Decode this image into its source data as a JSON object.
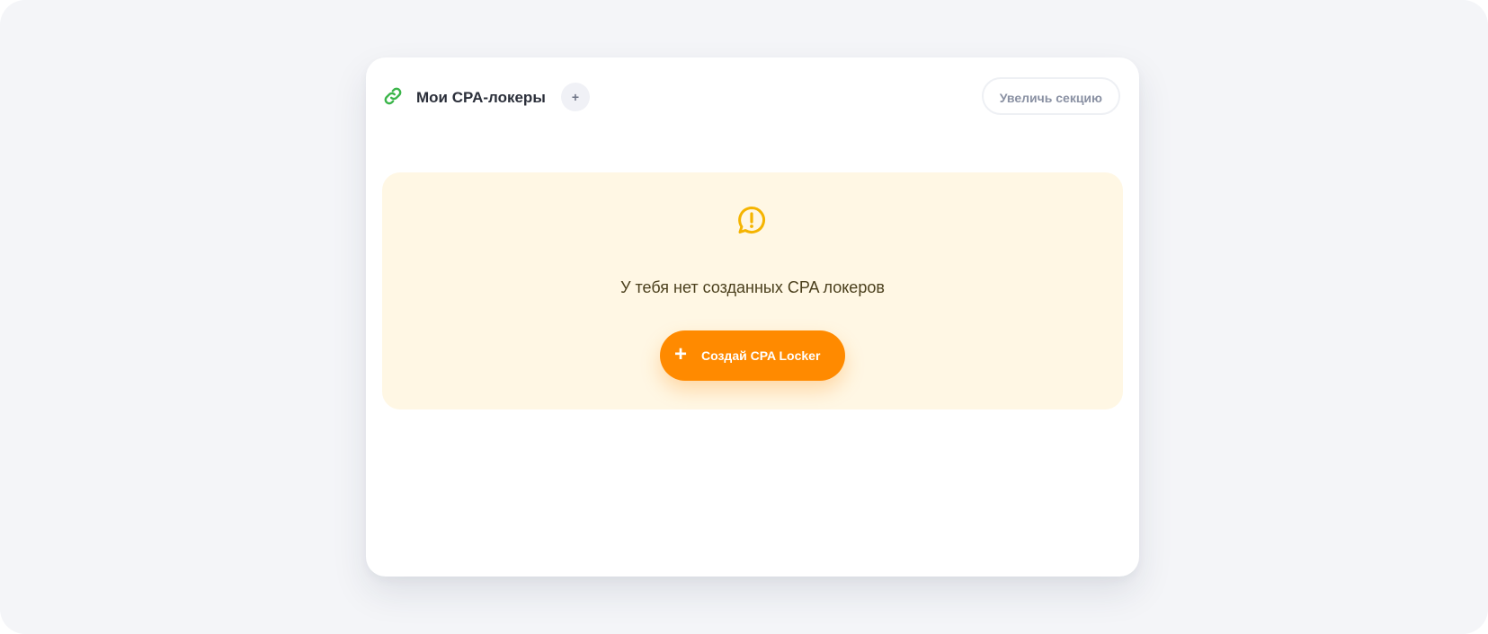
{
  "card": {
    "title": "Мои CPA-локеры",
    "add_label": "+",
    "expand_label": "Увеличь секцию",
    "title_icon": "link-icon"
  },
  "empty_state": {
    "icon": "alert-bubble-icon",
    "message": "У тебя нет созданных CPA локеров",
    "create_icon": "plus-icon",
    "create_label": "Создай CPA Locker"
  },
  "colors": {
    "page_background": "#f4f5f8",
    "card_background": "#ffffff",
    "link_icon": "#3bb54a",
    "empty_panel_background": "#fff7e4",
    "alert_icon": "#f5b400",
    "message_text": "#4a3f1c",
    "primary_button": "#ff8a00"
  }
}
